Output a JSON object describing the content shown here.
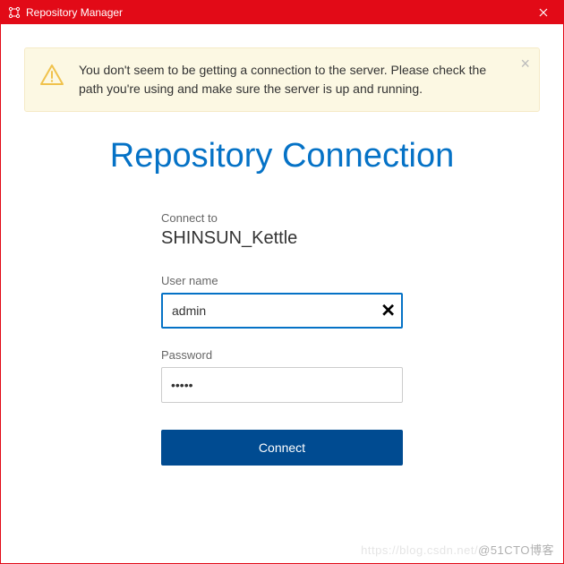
{
  "window": {
    "title": "Repository Manager"
  },
  "alert": {
    "message": "You don't seem to be getting a connection to the server. Please check the path you're using and make sure the server is up and running."
  },
  "page": {
    "title": "Repository Connection"
  },
  "form": {
    "connect_to_label": "Connect to",
    "repo_name": "SHINSUN_Kettle",
    "username_label": "User name",
    "username_value": "admin",
    "password_label": "Password",
    "password_value": "•••••",
    "connect_button": "Connect"
  },
  "watermark": {
    "left": "https://blog.csdn.net/",
    "right": "@51CTO博客"
  }
}
